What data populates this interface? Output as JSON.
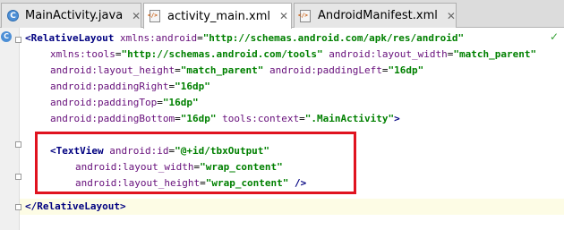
{
  "tabs": [
    {
      "label": "MainActivity.java",
      "close": "✕",
      "icon": "c-class-icon"
    },
    {
      "label": "activity_main.xml",
      "close": "✕",
      "icon": "xml-file-icon"
    },
    {
      "label": "AndroidManifest.xml",
      "close": "✕",
      "icon": "xml-file-icon"
    }
  ],
  "gutter": {
    "class_icon": "C"
  },
  "status": {
    "check_mark": "✓"
  },
  "code": {
    "l1": {
      "lt": "<",
      "tag": "RelativeLayout",
      "sp": " ",
      "attr": "xmlns:android",
      "eq": "=",
      "val": "\"http://schemas.android.com/apk/res/android\""
    },
    "l2": {
      "attr1": "xmlns:tools",
      "eq1": "=",
      "val1": "\"http://schemas.android.com/tools\"",
      "sp": " ",
      "attr2": "android:layout_width",
      "eq2": "=",
      "val2": "\"match_parent\""
    },
    "l3": {
      "attr1": "android:layout_height",
      "eq1": "=",
      "val1": "\"match_parent\"",
      "sp": " ",
      "attr2": "android:paddingLeft",
      "eq2": "=",
      "val2": "\"16dp\""
    },
    "l4": {
      "attr": "android:paddingRight",
      "eq": "=",
      "val": "\"16dp\""
    },
    "l5": {
      "attr": "android:paddingTop",
      "eq": "=",
      "val": "\"16dp\""
    },
    "l6": {
      "attr1": "android:paddingBottom",
      "eq1": "=",
      "val1": "\"16dp\"",
      "sp": " ",
      "attr2": "tools:context",
      "eq2": "=",
      "val2": "\".MainActivity\"",
      "gt": ">"
    },
    "l8": {
      "lt": "<",
      "tag": "TextView",
      "sp": " ",
      "attr": "android:id",
      "eq": "=",
      "val": "\"@+id/tbxOutput\""
    },
    "l9": {
      "attr": "android:layout_width",
      "eq": "=",
      "val": "\"wrap_content\""
    },
    "l10": {
      "attr": "android:layout_height",
      "eq": "=",
      "val": "\"wrap_content\"",
      "end": " />"
    },
    "l12": {
      "lt": "</",
      "tag": "RelativeLayout",
      "gt": ">"
    }
  }
}
